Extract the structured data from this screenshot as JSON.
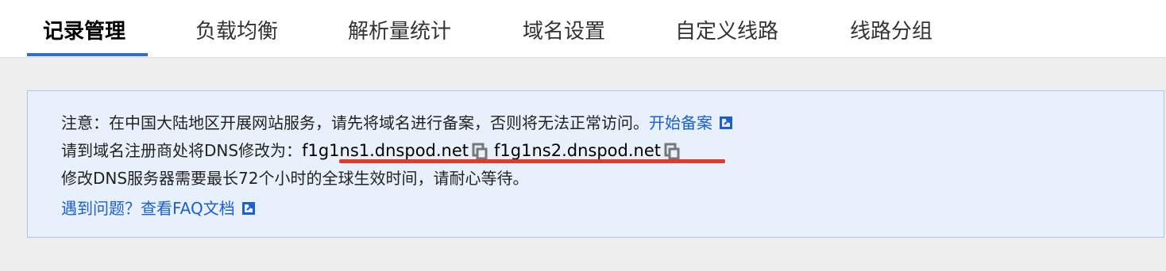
{
  "tabs": [
    {
      "label": "记录管理",
      "active": true
    },
    {
      "label": "负载均衡",
      "active": false
    },
    {
      "label": "解析量统计",
      "active": false
    },
    {
      "label": "域名设置",
      "active": false
    },
    {
      "label": "自定义线路",
      "active": false
    },
    {
      "label": "线路分组",
      "active": false
    }
  ],
  "notice": {
    "line1_text": "注意：在中国大陆地区开展网站服务，请先将域名进行备案，否则将无法正常访问。",
    "line1_link": "开始备案",
    "line2_prefix": "请到域名注册商处将DNS修改为：",
    "ns1": "f1g1ns1.dnspod.net",
    "ns2": "f1g1ns2.dnspod.net",
    "line3_text": "修改DNS服务器需要最长72个小时的全球生效时间，请耐心等待。",
    "line4_link": "遇到问题？查看FAQ文档"
  },
  "colors": {
    "accent": "#2d6ce8",
    "link": "#1a5fd6",
    "notice_bg": "#e8f0fc",
    "notice_border": "#a9c6f2",
    "highlight": "#e23a2a"
  },
  "icons": [
    "external-link-icon",
    "copy-icon"
  ]
}
